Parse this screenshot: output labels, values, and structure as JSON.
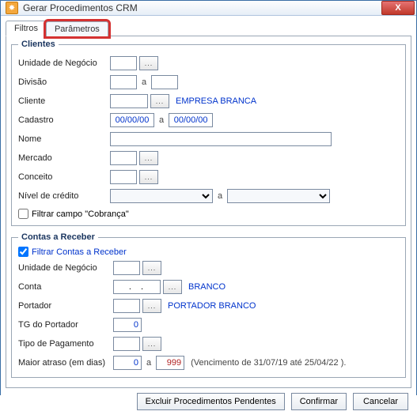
{
  "window": {
    "title": "Gerar Procedimentos CRM",
    "close_tip": "X"
  },
  "tabs": {
    "filtros": "Filtros",
    "parametros": "Parâmetros"
  },
  "clientes": {
    "legend": "Clientes",
    "unidade_label": "Unidade de Negócio",
    "unidade_value": "",
    "divisao_label": "Divisão",
    "divisao_from": "",
    "divisao_sep": "a",
    "divisao_to": "",
    "cliente_label": "Cliente",
    "cliente_value": "",
    "cliente_lookup_text": "EMPRESA BRANCA",
    "cadastro_label": "Cadastro",
    "cadastro_from": "00/00/00",
    "cadastro_sep": "a",
    "cadastro_to": "00/00/00",
    "nome_label": "Nome",
    "nome_value": "",
    "mercado_label": "Mercado",
    "mercado_value": "",
    "conceito_label": "Conceito",
    "conceito_value": "",
    "nivel_label": "Nível de crédito",
    "nivel_from": "",
    "nivel_sep": "a",
    "nivel_to": "",
    "filtrar_cobranca_label": "Filtrar campo \"Cobrança\"",
    "filtrar_cobranca_checked": false,
    "lookup_dots": "..."
  },
  "contas": {
    "legend": "Contas a Receber",
    "filtrar_label": "Filtrar Contas a Receber",
    "filtrar_checked": true,
    "unidade_label": "Unidade de Negócio",
    "unidade_value": "",
    "conta_label": "Conta",
    "conta_value": ".  .",
    "conta_lookup_text": "BRANCO",
    "portador_label": "Portador",
    "portador_value": "",
    "portador_lookup_text": "PORTADOR BRANCO",
    "tg_label": "TG do Portador",
    "tg_value": "0",
    "tipo_pag_label": "Tipo de Pagamento",
    "tipo_pag_value": "",
    "atraso_label": "Maior atraso (em dias)",
    "atraso_from": "0",
    "atraso_sep": "a",
    "atraso_to": "999",
    "atraso_hint": "(Vencimento de  31/07/19  até  25/04/22 ).",
    "lookup_dots": "..."
  },
  "buttons": {
    "excluir": "Excluir Procedimentos Pendentes",
    "confirmar": "Confirmar",
    "cancelar": "Cancelar"
  }
}
